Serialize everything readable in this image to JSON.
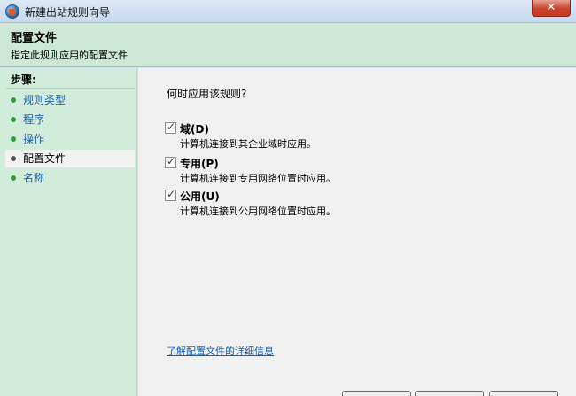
{
  "window": {
    "title": "新建出站规则向导",
    "close_glyph": "✕"
  },
  "header": {
    "title": "配置文件",
    "description": "指定此规则应用的配置文件"
  },
  "sidebar": {
    "steps_label": "步骤:",
    "items": [
      {
        "label": "规则类型",
        "active": false
      },
      {
        "label": "程序",
        "active": false
      },
      {
        "label": "操作",
        "active": false
      },
      {
        "label": "配置文件",
        "active": true
      },
      {
        "label": "名称",
        "active": false
      }
    ]
  },
  "main": {
    "question": "何时应用该规则?",
    "options": [
      {
        "label": "域(D)",
        "description": "计算机连接到其企业域时应用。",
        "checked": true
      },
      {
        "label": "专用(P)",
        "description": "计算机连接到专用网络位置时应用。",
        "checked": true
      },
      {
        "label": "公用(U)",
        "description": "计算机连接到公用网络位置时应用。",
        "checked": true
      }
    ],
    "learn_more_link": "了解配置文件的详细信息"
  },
  "colors": {
    "header_bg": "#cde8d6",
    "sidebar_bg": "#d2ecdc",
    "link": "#0b5fb4",
    "close_button": "#c8412a"
  }
}
